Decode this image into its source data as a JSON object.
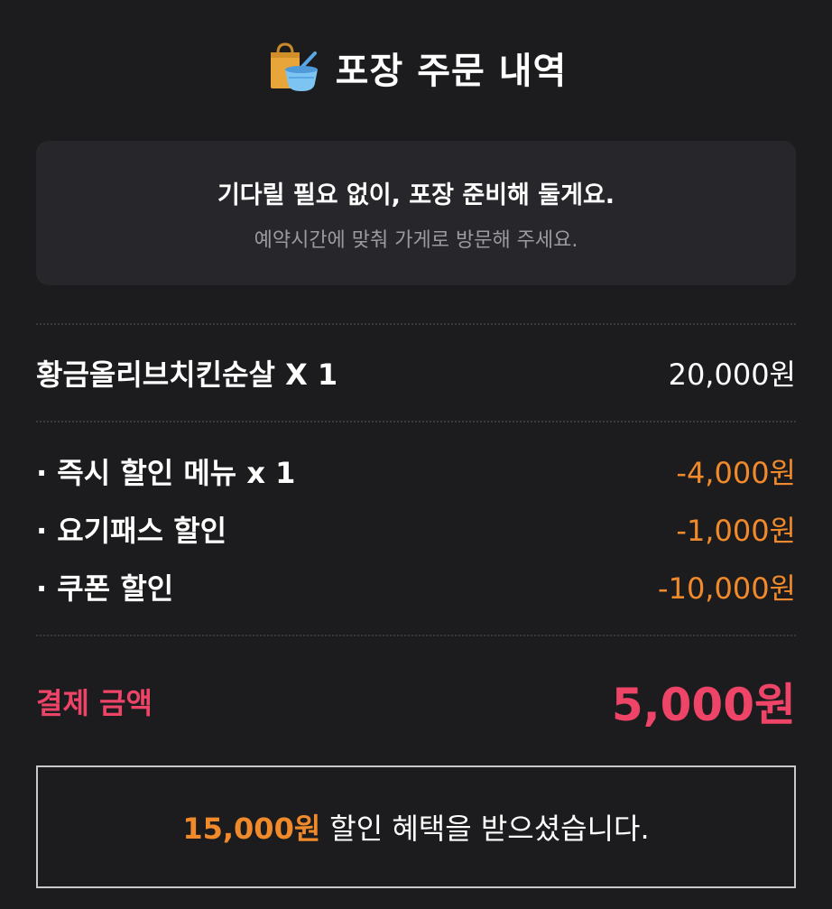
{
  "header": {
    "icon": "takeout-bag-bowl-icon",
    "title": "포장 주문 내역"
  },
  "info": {
    "main": "기다릴 필요 없이, 포장 준비해 둘게요.",
    "sub": "예약시간에 맞춰 가게로 방문해 주세요."
  },
  "order_item": {
    "name": "황금올리브치킨순살 X 1",
    "price": "20,000원"
  },
  "discounts": [
    {
      "label": "· 즉시 할인 메뉴 x 1",
      "amount": "-4,000원"
    },
    {
      "label": "· 요기패스 할인",
      "amount": "-1,000원"
    },
    {
      "label": "· 쿠폰 할인",
      "amount": "-10,000원"
    }
  ],
  "total": {
    "label": "결제 금액",
    "amount": "5,000원"
  },
  "savings": {
    "amount": "15,000원",
    "text": "할인 혜택을 받으셨습니다."
  },
  "colors": {
    "background": "#1c1c1e",
    "card": "#27272b",
    "discount": "#f18a2b",
    "total": "#ee4467"
  }
}
